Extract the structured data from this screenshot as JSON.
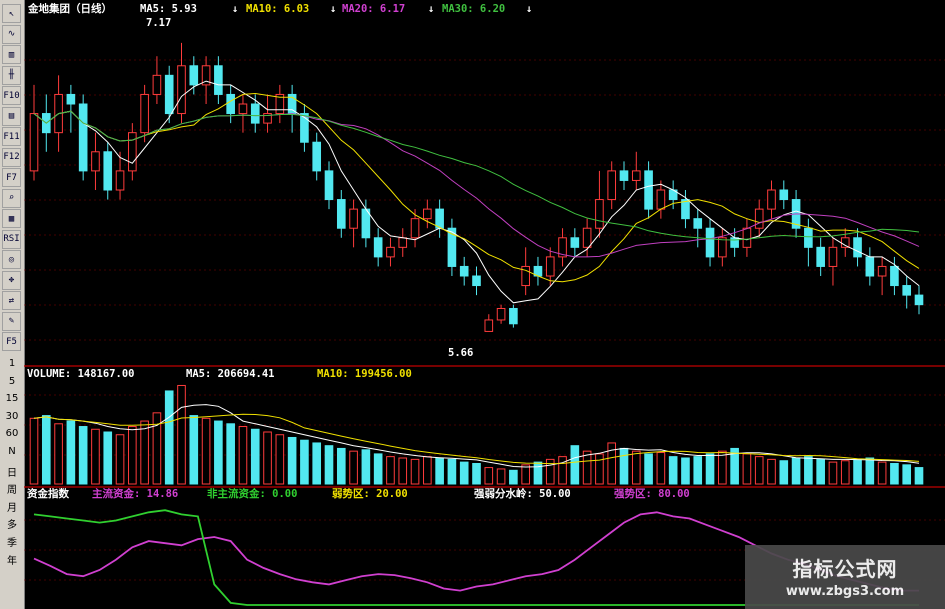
{
  "toolbar": {
    "icons": [
      "cursor-icon",
      "line-chart-icon",
      "bar-chart-icon",
      "candle-icon",
      "f10-icon",
      "note-icon",
      "f11-icon",
      "f12-icon",
      "f7-icon",
      "zoom-icon",
      "indicator-icon",
      "rsi-icon",
      "win-icon",
      "move-icon",
      "exit-icon",
      "pencil-icon",
      "f5-icon"
    ],
    "icon_labels": [
      "↖",
      "∿",
      "▥",
      "╫",
      "F10",
      "▤",
      "F11",
      "F12",
      "F7",
      "⌕",
      "▦",
      "RSI",
      "◎",
      "✥",
      "⇄",
      "✎",
      "F5"
    ],
    "bottom_labels": [
      "1",
      "5",
      "15",
      "30",
      "60",
      "N",
      "日",
      "周",
      "月",
      "多",
      "季",
      "年"
    ]
  },
  "header": {
    "stock": "金地集团（日线）",
    "ma5": "MA5: 5.93",
    "ma10": "MA10: 6.03",
    "ma20": "MA20: 6.17",
    "ma30": "MA30: 6.20",
    "arrow": "↓"
  },
  "annotations": {
    "high": "7.17",
    "low": "5.66"
  },
  "volume_header": {
    "volume": "VOLUME: 148167.00",
    "ma5": "MA5: 206694.41",
    "ma10": "MA10: 199456.00"
  },
  "indicator_header": {
    "name": "资金指数",
    "main_fund": "主流资金: 14.86",
    "non_main": "非主流资金: 0.00",
    "weak_zone": "弱势区: 20.00",
    "divide": "强弱分水岭: 50.00",
    "strong_zone": "强势区: 80.00"
  },
  "watermark": {
    "title": "指标公式网",
    "url": "www.zbgs3.com"
  },
  "colors": {
    "up": "#ff3c3c",
    "down": "#52e8f0",
    "ma5": "#ffffff",
    "ma10": "#f0e000",
    "ma20": "#c040c0",
    "ma30": "#40c040",
    "main_fund": "#d040d0",
    "non_main": "#30d030",
    "grid": "#8b0000"
  },
  "chart_data": [
    {
      "type": "candlestick",
      "title": "金地集团（日线）",
      "ylim": [
        5.5,
        7.3
      ],
      "annotations": [
        {
          "label": "7.17",
          "value": 7.17
        },
        {
          "label": "5.66",
          "value": 5.66
        }
      ],
      "candles": [
        [
          6.5,
          6.8,
          6.95,
          6.45
        ],
        [
          6.8,
          6.7,
          6.9,
          6.6
        ],
        [
          6.7,
          6.9,
          7.0,
          6.6
        ],
        [
          6.9,
          6.85,
          6.95,
          6.7
        ],
        [
          6.85,
          6.5,
          6.9,
          6.45
        ],
        [
          6.5,
          6.6,
          6.7,
          6.4
        ],
        [
          6.6,
          6.4,
          6.65,
          6.35
        ],
        [
          6.4,
          6.5,
          6.6,
          6.35
        ],
        [
          6.5,
          6.7,
          6.75,
          6.45
        ],
        [
          6.7,
          6.9,
          6.95,
          6.65
        ],
        [
          6.9,
          7.0,
          7.1,
          6.85
        ],
        [
          7.0,
          6.8,
          7.05,
          6.75
        ],
        [
          6.8,
          7.05,
          7.17,
          6.75
        ],
        [
          7.05,
          6.95,
          7.1,
          6.9
        ],
        [
          6.95,
          7.05,
          7.1,
          6.85
        ],
        [
          7.05,
          6.9,
          7.1,
          6.85
        ],
        [
          6.9,
          6.8,
          6.95,
          6.75
        ],
        [
          6.8,
          6.85,
          6.9,
          6.7
        ],
        [
          6.85,
          6.75,
          6.9,
          6.7
        ],
        [
          6.75,
          6.8,
          6.9,
          6.7
        ],
        [
          6.8,
          6.9,
          6.95,
          6.75
        ],
        [
          6.9,
          6.8,
          6.95,
          6.7
        ],
        [
          6.8,
          6.65,
          6.85,
          6.6
        ],
        [
          6.65,
          6.5,
          6.7,
          6.45
        ],
        [
          6.5,
          6.35,
          6.55,
          6.3
        ],
        [
          6.35,
          6.2,
          6.4,
          6.15
        ],
        [
          6.2,
          6.3,
          6.35,
          6.1
        ],
        [
          6.3,
          6.15,
          6.35,
          6.1
        ],
        [
          6.15,
          6.05,
          6.2,
          6.0
        ],
        [
          6.05,
          6.1,
          6.15,
          6.0
        ],
        [
          6.1,
          6.15,
          6.2,
          6.05
        ],
        [
          6.15,
          6.25,
          6.3,
          6.1
        ],
        [
          6.25,
          6.3,
          6.35,
          6.2
        ],
        [
          6.3,
          6.2,
          6.35,
          6.15
        ],
        [
          6.2,
          6.0,
          6.25,
          5.95
        ],
        [
          6.0,
          5.95,
          6.05,
          5.9
        ],
        [
          5.95,
          5.9,
          6.0,
          5.85
        ],
        [
          5.66,
          5.72,
          5.75,
          5.66
        ],
        [
          5.72,
          5.78,
          5.8,
          5.7
        ],
        [
          5.78,
          5.7,
          5.8,
          5.68
        ],
        [
          5.9,
          6.0,
          6.1,
          5.85
        ],
        [
          6.0,
          5.95,
          6.05,
          5.9
        ],
        [
          5.95,
          6.05,
          6.1,
          5.9
        ],
        [
          6.05,
          6.15,
          6.2,
          6.0
        ],
        [
          6.15,
          6.1,
          6.2,
          6.05
        ],
        [
          6.1,
          6.2,
          6.25,
          6.05
        ],
        [
          6.2,
          6.35,
          6.5,
          6.15
        ],
        [
          6.35,
          6.5,
          6.55,
          6.3
        ],
        [
          6.5,
          6.45,
          6.55,
          6.4
        ],
        [
          6.45,
          6.5,
          6.6,
          6.4
        ],
        [
          6.5,
          6.3,
          6.55,
          6.25
        ],
        [
          6.3,
          6.4,
          6.45,
          6.25
        ],
        [
          6.4,
          6.35,
          6.45,
          6.3
        ],
        [
          6.35,
          6.25,
          6.4,
          6.2
        ],
        [
          6.25,
          6.2,
          6.3,
          6.1
        ],
        [
          6.2,
          6.05,
          6.25,
          6.0
        ],
        [
          6.05,
          6.15,
          6.2,
          6.0
        ],
        [
          6.15,
          6.1,
          6.2,
          6.05
        ],
        [
          6.1,
          6.2,
          6.25,
          6.05
        ],
        [
          6.2,
          6.3,
          6.35,
          6.15
        ],
        [
          6.3,
          6.4,
          6.45,
          6.25
        ],
        [
          6.4,
          6.35,
          6.45,
          6.3
        ],
        [
          6.35,
          6.2,
          6.4,
          6.15
        ],
        [
          6.2,
          6.1,
          6.25,
          6.0
        ],
        [
          6.1,
          6.0,
          6.15,
          5.95
        ],
        [
          6.0,
          6.1,
          6.15,
          5.9
        ],
        [
          6.1,
          6.15,
          6.2,
          6.05
        ],
        [
          6.15,
          6.05,
          6.2,
          6.0
        ],
        [
          6.05,
          5.95,
          6.1,
          5.9
        ],
        [
          5.95,
          6.0,
          6.05,
          5.85
        ],
        [
          6.0,
          5.9,
          6.05,
          5.85
        ],
        [
          5.9,
          5.85,
          5.95,
          5.78
        ],
        [
          5.85,
          5.8,
          5.9,
          5.75
        ]
      ]
    },
    {
      "type": "bar",
      "title": "VOLUME",
      "values": [
        240,
        250,
        220,
        230,
        210,
        200,
        190,
        180,
        210,
        230,
        260,
        340,
        360,
        250,
        240,
        230,
        220,
        210,
        200,
        190,
        180,
        170,
        160,
        150,
        140,
        130,
        120,
        125,
        110,
        100,
        95,
        90,
        100,
        95,
        90,
        80,
        75,
        60,
        55,
        50,
        70,
        80,
        90,
        100,
        140,
        120,
        110,
        150,
        130,
        120,
        110,
        115,
        100,
        95,
        100,
        110,
        120,
        130,
        110,
        100,
        90,
        85,
        95,
        100,
        90,
        80,
        85,
        90,
        95,
        80,
        75,
        70,
        60
      ],
      "up": [
        1,
        0,
        1,
        0,
        0,
        1,
        0,
        1,
        1,
        1,
        1,
        0,
        1,
        0,
        1,
        0,
        0,
        1,
        0,
        1,
        1,
        0,
        0,
        0,
        0,
        0,
        1,
        0,
        0,
        1,
        1,
        1,
        1,
        0,
        0,
        0,
        0,
        1,
        1,
        0,
        1,
        0,
        1,
        1,
        0,
        1,
        1,
        1,
        0,
        1,
        0,
        1,
        0,
        0,
        0,
        0,
        1,
        0,
        1,
        1,
        1,
        0,
        0,
        0,
        0,
        1,
        1,
        0,
        0,
        1,
        0,
        0,
        0
      ]
    },
    {
      "type": "line",
      "title": "资金指数",
      "ylim": [
        0,
        100
      ],
      "series": [
        {
          "name": "主流资金",
          "values": [
            45,
            38,
            30,
            28,
            34,
            44,
            56,
            62,
            60,
            58,
            64,
            66,
            62,
            44,
            36,
            30,
            25,
            22,
            20,
            24,
            28,
            30,
            29,
            26,
            22,
            16,
            14,
            18,
            20,
            24,
            28,
            30,
            34,
            44,
            56,
            68,
            80,
            88,
            90,
            86,
            84,
            78,
            72,
            66,
            58,
            50,
            44,
            40,
            34,
            28,
            24,
            20,
            16,
            14,
            14
          ]
        },
        {
          "name": "非主流资金",
          "values": [
            88,
            86,
            84,
            82,
            80,
            82,
            86,
            90,
            92,
            88,
            86,
            20,
            2,
            0,
            0,
            0,
            0,
            0,
            0,
            0,
            0,
            0,
            0,
            0,
            0,
            0,
            0,
            0,
            0,
            0,
            0,
            0,
            0,
            0,
            0,
            0,
            0,
            0,
            0,
            0,
            0,
            0,
            0,
            0,
            0,
            0,
            0,
            0,
            0,
            0,
            0,
            0,
            0,
            0,
            0
          ]
        }
      ]
    }
  ]
}
